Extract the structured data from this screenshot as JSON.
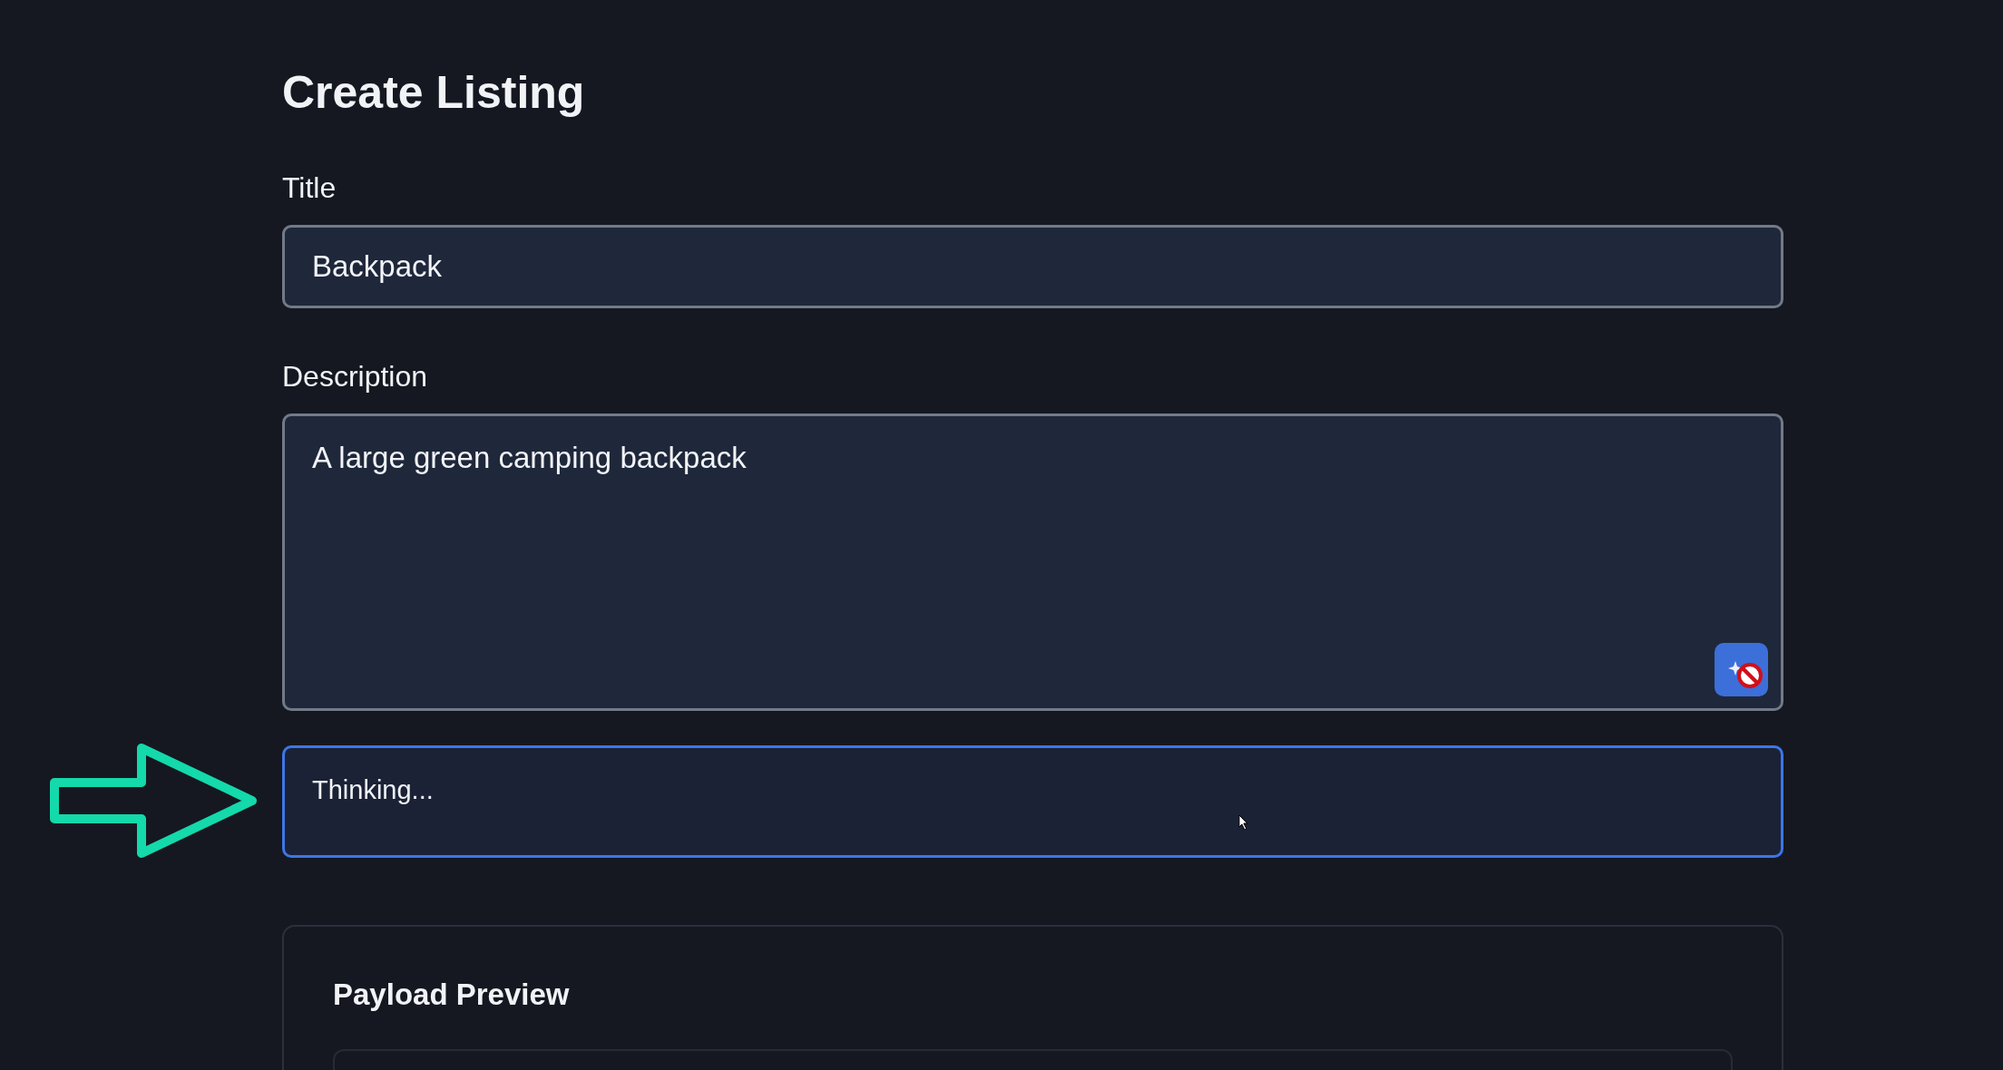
{
  "heading": "Create Listing",
  "fields": [
    {
      "kind": "input",
      "label": "Title",
      "value": "Backpack"
    },
    {
      "kind": "textarea",
      "label": "Description",
      "value": "A large green camping backpack"
    }
  ],
  "status": {
    "text": "Thinking..."
  },
  "preview": {
    "title": "Payload Preview"
  }
}
